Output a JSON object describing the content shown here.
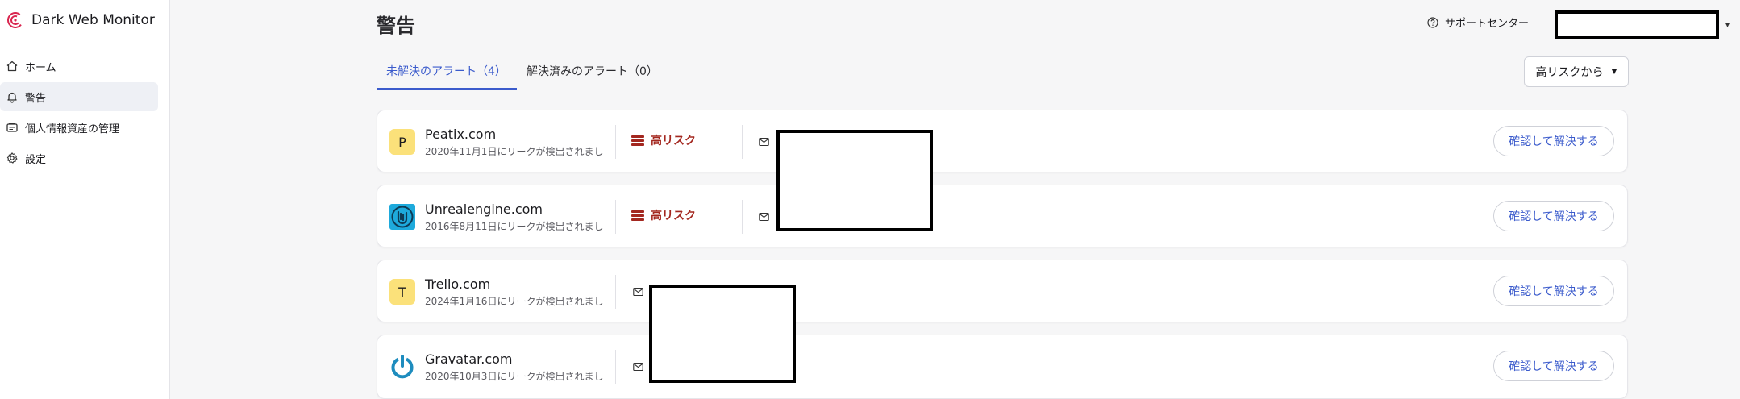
{
  "brand": {
    "name": "Dark Web Monitor",
    "accent": "#d9264f"
  },
  "sidebar": {
    "items": [
      {
        "label": "ホーム",
        "icon": "home-icon",
        "active": false
      },
      {
        "label": "警告",
        "icon": "bell-icon",
        "active": true
      },
      {
        "label": "個人情報資産の管理",
        "icon": "id-card-icon",
        "active": false
      },
      {
        "label": "設定",
        "icon": "gear-icon",
        "active": false
      }
    ]
  },
  "header": {
    "title": "警告",
    "support_label": "サポートセンター",
    "support_icon": "help-circle-icon"
  },
  "tabs": [
    {
      "label": "未解決のアラート（4）",
      "active": true
    },
    {
      "label": "解決済みのアラート（0）",
      "active": false
    }
  ],
  "sort": {
    "label": "高リスクから"
  },
  "colors": {
    "primary": "#3b5bcc",
    "risk_high": "#a3271f",
    "initial_bg": "#fbe17a"
  },
  "alerts": [
    {
      "site": "Peatix.com",
      "date_text": "2020年11月1日にリークが検出されまし",
      "icon": "P",
      "icon_type": "initial",
      "risk": "高リスク",
      "action": "確認して解決する"
    },
    {
      "site": "Unrealengine.com",
      "date_text": "2016年8月11日にリークが検出されまし",
      "icon": "unreal-logo-icon",
      "icon_type": "logo",
      "risk": "高リスク",
      "action": "確認して解決する"
    },
    {
      "site": "Trello.com",
      "date_text": "2024年1月16日にリークが検出されまし",
      "icon": "T",
      "icon_type": "initial",
      "risk": null,
      "action": "確認して解決する"
    },
    {
      "site": "Gravatar.com",
      "date_text": "2020年10月3日にリークが検出されまし",
      "icon": "gravatar-logo-icon",
      "icon_type": "logo",
      "risk": null,
      "action": "確認して解決する"
    }
  ]
}
